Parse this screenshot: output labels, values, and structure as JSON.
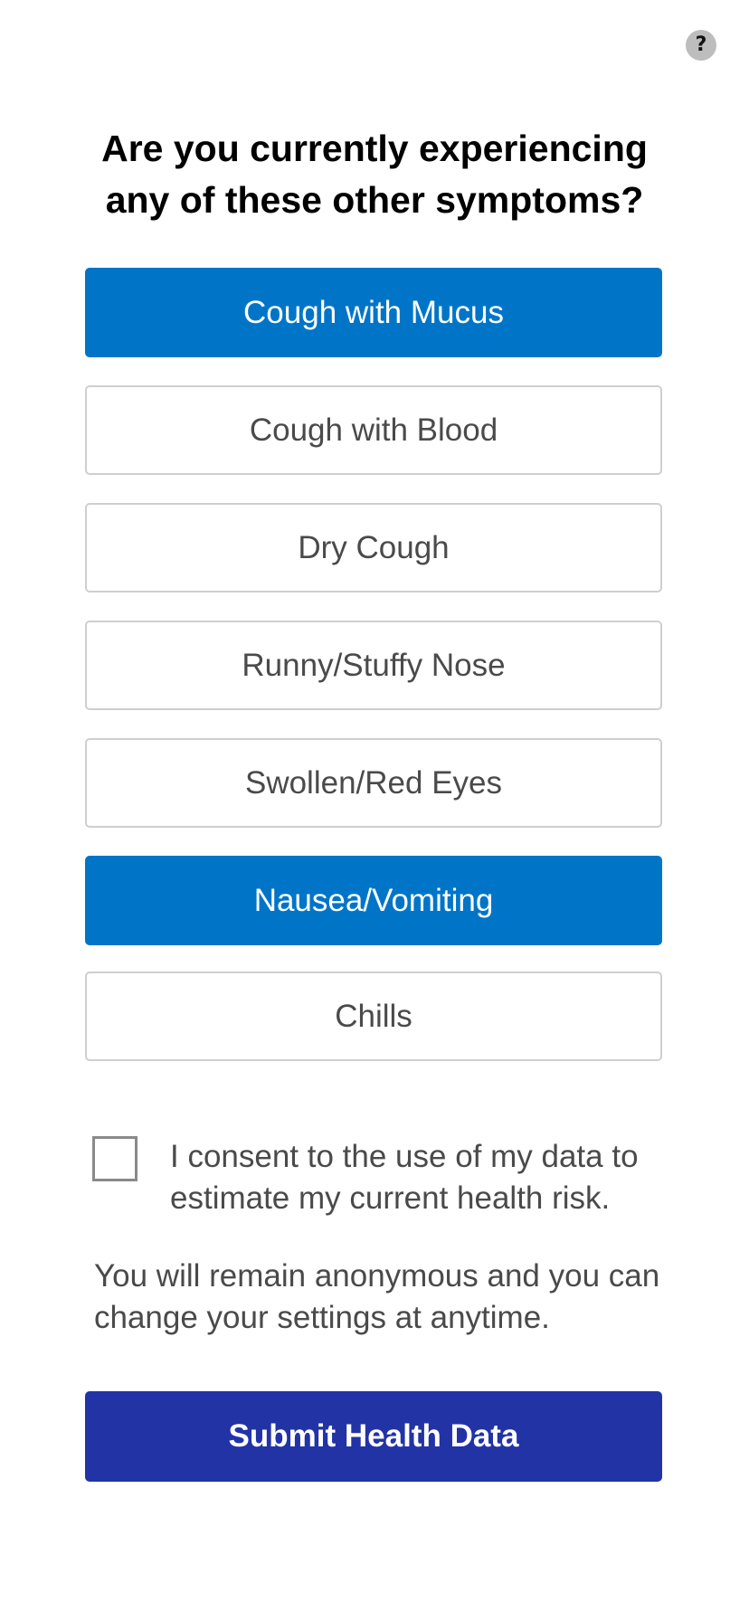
{
  "help": {
    "label": "?"
  },
  "title": "Are you currently experiencing any of these other symptoms?",
  "options": [
    {
      "label": "Cough with Mucus",
      "selected": true
    },
    {
      "label": "Cough with Blood",
      "selected": false
    },
    {
      "label": "Dry Cough",
      "selected": false
    },
    {
      "label": "Runny/Stuffy Nose",
      "selected": false
    },
    {
      "label": "Swollen/Red Eyes",
      "selected": false
    },
    {
      "label": "Nausea/Vomiting",
      "selected": true
    },
    {
      "label": "Chills",
      "selected": false
    }
  ],
  "consent": {
    "checked": false,
    "text": "I consent to the use of my data to estimate my current health risk."
  },
  "anonymity_note": "You will remain anonymous and you can change your settings at anytime.",
  "submit": {
    "label": "Submit Health Data"
  },
  "colors": {
    "selected": "#0075c8",
    "submit": "#2233a6"
  }
}
